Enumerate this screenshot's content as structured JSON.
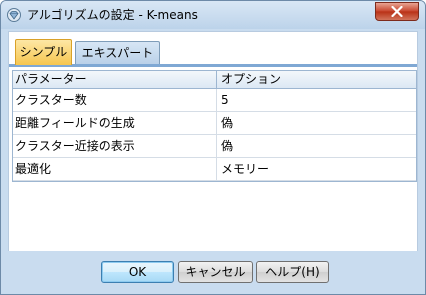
{
  "window": {
    "title": "アルゴリズムの設定 - K-means",
    "app_icon": "diamond-gem-icon",
    "close_icon": "close-icon"
  },
  "tabs": [
    {
      "label": "シンプル",
      "active": true
    },
    {
      "label": "エキスパート",
      "active": false
    }
  ],
  "table": {
    "headers": [
      "パラメーター",
      "オプション"
    ],
    "rows": [
      {
        "parameter": "クラスター数",
        "option": "5"
      },
      {
        "parameter": "距離フィールドの生成",
        "option": "偽"
      },
      {
        "parameter": "クラスター近接の表示",
        "option": "偽"
      },
      {
        "parameter": "最適化",
        "option": "メモリー"
      }
    ]
  },
  "buttons": {
    "ok": "OK",
    "cancel": "キャンセル",
    "help": "ヘルプ(H)"
  },
  "colors": {
    "active_tab": "#f6c64f",
    "window_frame": "#c9dcef",
    "close_button": "#c7432b"
  }
}
